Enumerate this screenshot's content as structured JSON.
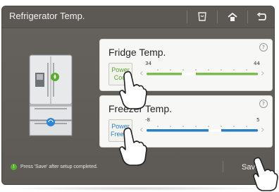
{
  "header": {
    "title": "Refrigerator Temp.",
    "icons": [
      "cup-icon",
      "home-icon",
      "back-icon"
    ]
  },
  "fridge_card": {
    "title": "Fridge Temp.",
    "button_label": "Power Cool",
    "min": "34",
    "max": "44",
    "accent": "#5aa531"
  },
  "freezer_card": {
    "title": "Freezer Temp.",
    "button_label": "Power Freeze",
    "min": "-8",
    "max": "5",
    "accent": "#2a7fca"
  },
  "footer": {
    "info_text": "Press 'Save' after setup completed.",
    "save_label": "Save"
  }
}
